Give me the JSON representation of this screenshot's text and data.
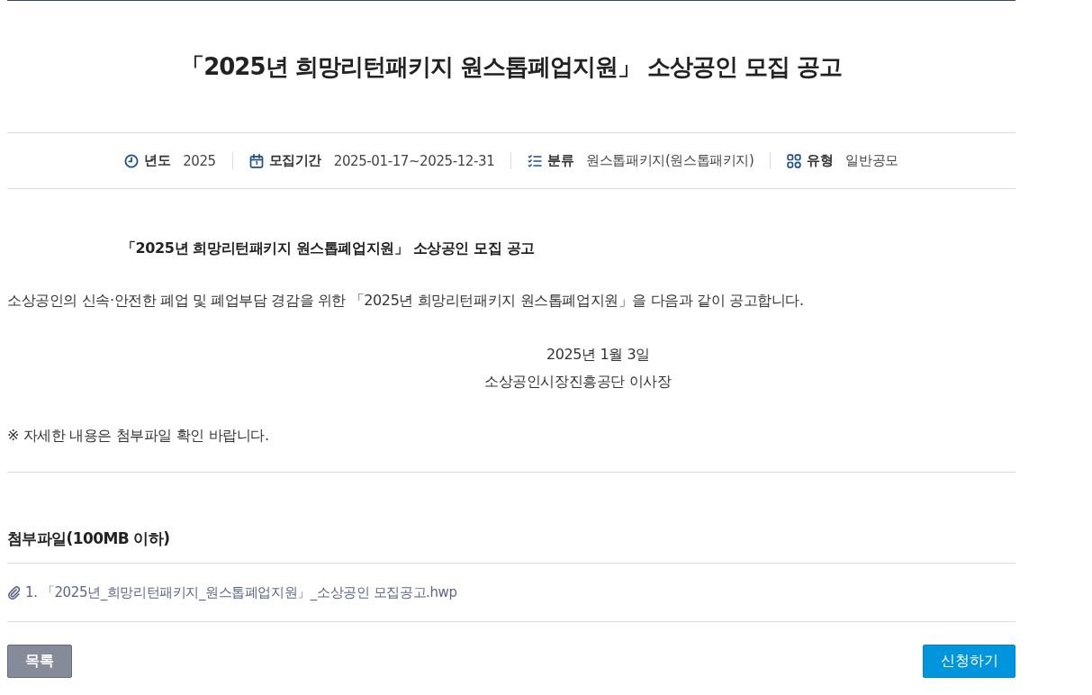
{
  "title": "「2025년 희망리턴패키지 원스톱폐업지원」 소상공인 모집 공고",
  "meta": [
    {
      "kind": "year",
      "label": "년도",
      "value": "2025"
    },
    {
      "kind": "period",
      "label": "모집기간",
      "value": "2025-01-17~2025-12-31"
    },
    {
      "kind": "category",
      "label": "분류",
      "value": "원스톱패키지(원스톱패키지)"
    },
    {
      "kind": "type",
      "label": "유형",
      "value": "일반공모"
    }
  ],
  "body": {
    "heading": "「2025년 희망리턴패키지 원스톱폐업지원」 소상공인 모집 공고",
    "intro": "소상공인의 신속·안전한 폐업 및 폐업부담 경감을 위한 「2025년 희망리턴패키지 원스톱폐업지원」을 다음과 같이 공고합니다.",
    "date": "2025년 1월 3일",
    "issuer": "소상공인시장진흥공단 이사장",
    "note": "※ 자세한 내용은 첨부파일 확인 바랍니다."
  },
  "attachments": {
    "heading": "첨부파일(100MB 이하)",
    "files": [
      {
        "name": "1. 「2025년_희망리턴패키지_원스톱폐업지원」_소상공인 모집공고.hwp"
      }
    ]
  },
  "buttons": [
    {
      "kind": "secondary",
      "label": "목록"
    },
    {
      "kind": "primary",
      "label": "신청하기"
    }
  ]
}
